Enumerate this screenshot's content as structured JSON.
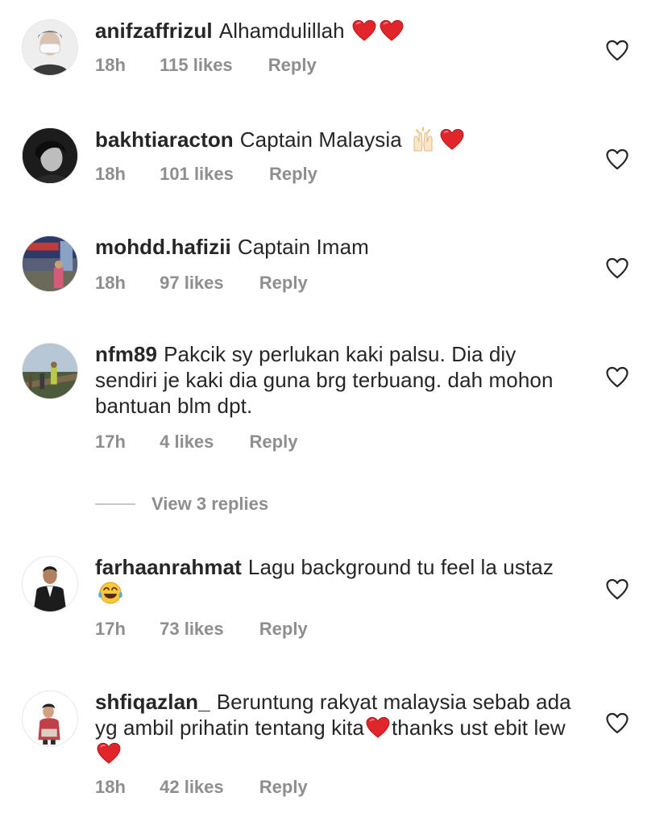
{
  "comments": [
    {
      "username": "anifzaffrizul",
      "text": "Alhamdulillah",
      "emoji_after": [
        "red-heart",
        "red-heart"
      ],
      "time": "18h",
      "likes": "115 likes",
      "reply": "Reply"
    },
    {
      "username": "bakhtiaracton",
      "text": "Captain Malaysia",
      "emoji_after": [
        "raising-hands",
        "red-heart"
      ],
      "time": "18h",
      "likes": "101 likes",
      "reply": "Reply"
    },
    {
      "username": "mohdd.hafizii",
      "text": "Captain Imam",
      "emoji_after": [],
      "time": "18h",
      "likes": "97 likes",
      "reply": "Reply"
    },
    {
      "username": "nfm89",
      "text": "Pakcik sy perlukan kaki palsu. Dia diy sendiri je kaki dia guna brg terbuang. dah mohon bantuan blm dpt.",
      "emoji_after": [],
      "time": "17h",
      "likes": "4 likes",
      "reply": "Reply"
    },
    {
      "username": "farhaanrahmat",
      "text": "Lagu background tu feel la ustaz",
      "emoji_after": [
        "tears-of-joy"
      ],
      "time": "17h",
      "likes": "73 likes",
      "reply": "Reply"
    },
    {
      "username": "shfiqazlan_",
      "text_part1": "Beruntung rakyat malaysia sebab ada yg ambil prihatin tentang kita",
      "text_part2": "thanks ust ebit lew",
      "time": "18h",
      "likes": "42 likes",
      "reply": "Reply"
    }
  ],
  "view_replies": "View 3 replies",
  "icons": {
    "like": "heart-outline-icon",
    "heart_color": "#e0262b",
    "meta_color": "#8e8e8e",
    "text_color": "#262626"
  }
}
